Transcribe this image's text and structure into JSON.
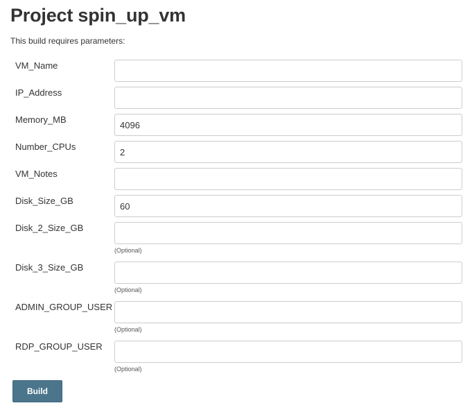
{
  "page": {
    "title": "Project spin_up_vm",
    "subtitle": "This build requires parameters:"
  },
  "parameters": [
    {
      "name": "VM_Name",
      "value": "",
      "hint": ""
    },
    {
      "name": "IP_Address",
      "value": "",
      "hint": ""
    },
    {
      "name": "Memory_MB",
      "value": "4096",
      "hint": ""
    },
    {
      "name": "Number_CPUs",
      "value": "2",
      "hint": ""
    },
    {
      "name": "VM_Notes",
      "value": "",
      "hint": ""
    },
    {
      "name": "Disk_Size_GB",
      "value": "60",
      "hint": ""
    },
    {
      "name": "Disk_2_Size_GB",
      "value": "",
      "hint": "(Optional)"
    },
    {
      "name": "Disk_3_Size_GB",
      "value": "",
      "hint": "(Optional)"
    },
    {
      "name": "ADMIN_GROUP_USER",
      "value": "",
      "hint": "(Optional)"
    },
    {
      "name": "RDP_GROUP_USER",
      "value": "",
      "hint": "(Optional)"
    }
  ],
  "actions": {
    "build_label": "Build"
  }
}
